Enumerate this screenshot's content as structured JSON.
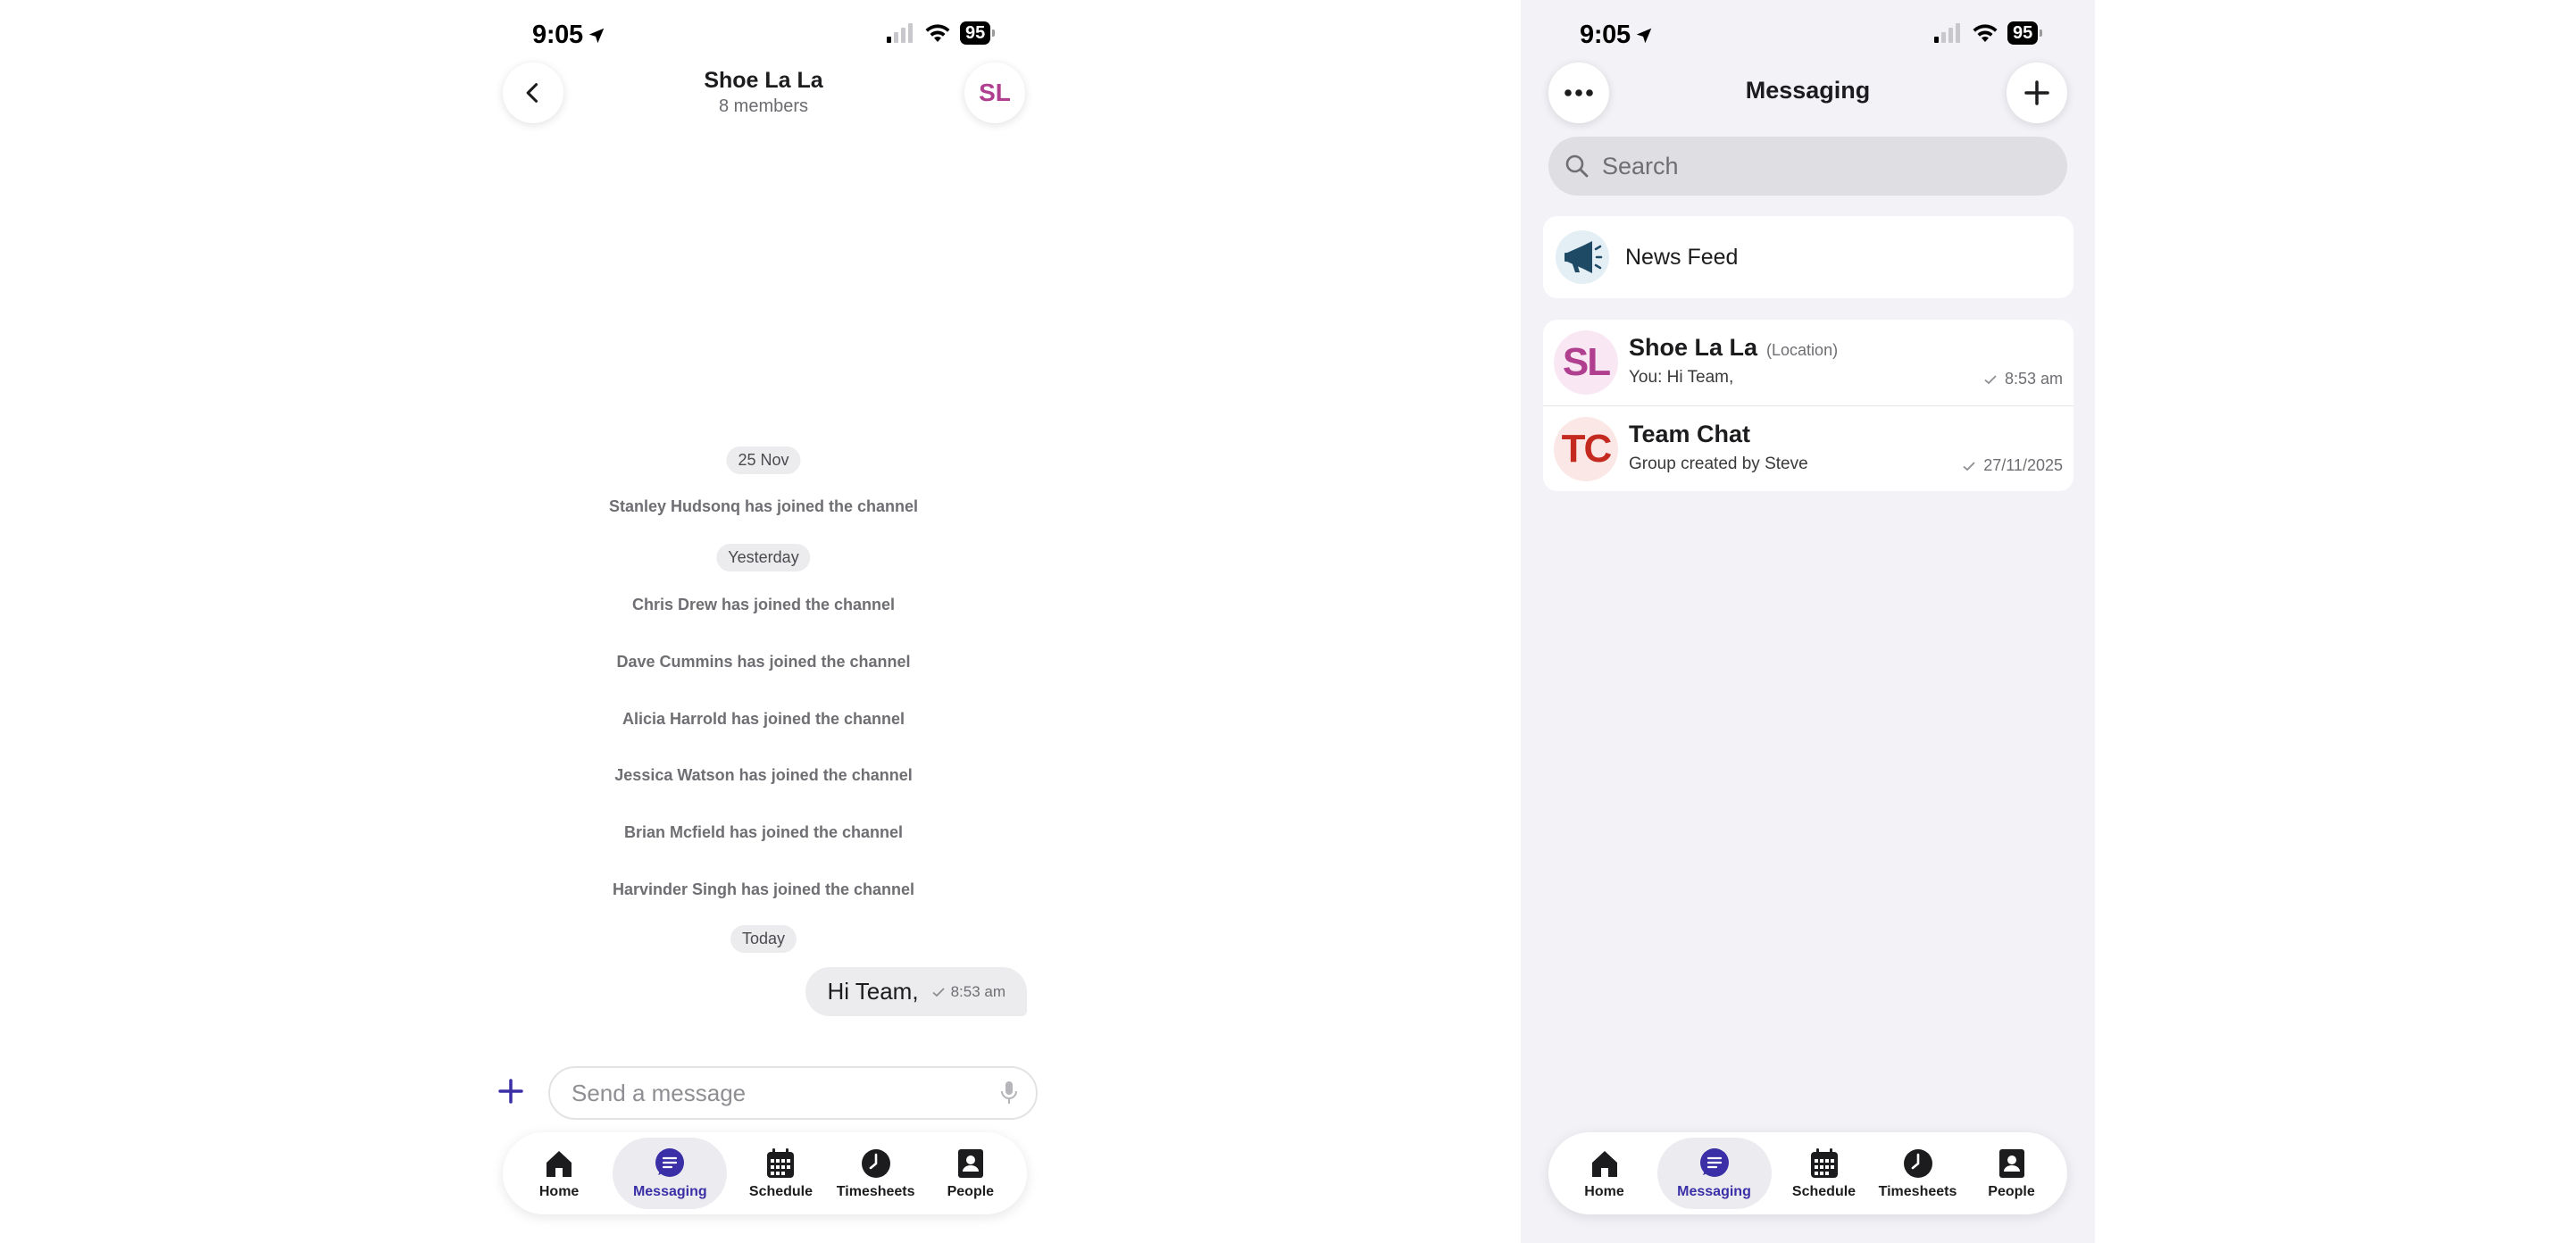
{
  "left": {
    "status": {
      "time": "9:05",
      "battery": "95"
    },
    "header": {
      "title": "Shoe La La",
      "subtitle": "8 members",
      "avatar_initials": "SL"
    },
    "messages": {
      "date_1": "25 Nov",
      "sys_1": "Stanley Hudsonq has joined the channel",
      "date_2": "Yesterday",
      "sys_2": "Chris Drew has joined the channel",
      "sys_3": "Dave Cummins has joined the channel",
      "sys_4": "Alicia Harrold has joined the channel",
      "sys_5": "Jessica Watson has joined the channel",
      "sys_6": "Brian Mcfield has joined the channel",
      "sys_7": "Harvinder Singh has joined the channel",
      "date_3": "Today",
      "bubble_text": "Hi Team,",
      "bubble_time": "8:53 am"
    },
    "composer": {
      "placeholder": "Send a message"
    }
  },
  "right": {
    "status": {
      "time": "9:05",
      "battery": "95"
    },
    "header": {
      "title": "Messaging"
    },
    "search": {
      "placeholder": "Search"
    },
    "news_feed": {
      "label": "News Feed"
    },
    "chats": [
      {
        "initials": "SL",
        "name": "Shoe La La",
        "tag": "(Location)",
        "preview": "You: Hi Team,",
        "time": "8:53 am"
      },
      {
        "initials": "TC",
        "name": "Team Chat",
        "tag": "",
        "preview": "Group created by Steve",
        "time": "27/11/2025"
      }
    ]
  },
  "tabbar": {
    "home": "Home",
    "messaging": "Messaging",
    "schedule": "Schedule",
    "timesheets": "Timesheets",
    "people": "People"
  },
  "colors": {
    "accent": "#3a2fa6",
    "sl_avatar": "#b0408f",
    "tc_avatar": "#c42a1f",
    "newsfeed_icon": "#1f4a66"
  },
  "icons": {
    "back": "chevron-left-icon",
    "more": "ellipsis-icon",
    "compose": "plus-icon",
    "search": "search-icon",
    "mic": "microphone-icon",
    "news_feed": "megaphone-icon",
    "read": "checkmark-icon",
    "home": "house-icon",
    "messaging": "chat-bubble-icon",
    "schedule": "calendar-icon",
    "timesheets": "clock-icon",
    "people": "contact-book-icon"
  }
}
